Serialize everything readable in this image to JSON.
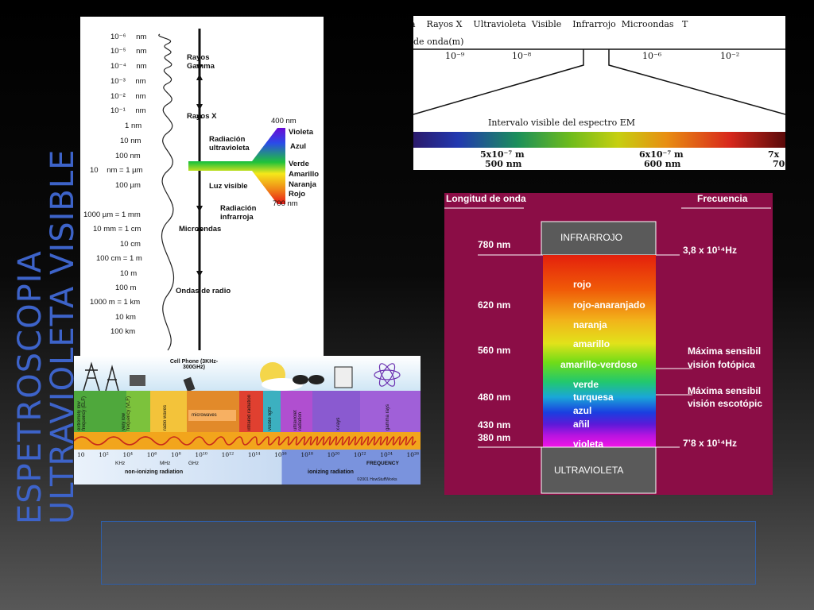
{
  "slide": {
    "title": "ESPETROSCOPIA ULTRAVIOLETA VISIBLE"
  },
  "em_spectrum": {
    "scale_ticks": [
      "10⁻⁶",
      "10⁻⁵",
      "10⁻⁴",
      "10⁻³",
      "10⁻²",
      "10⁻¹",
      "1",
      "10",
      "100",
      "10",
      "100",
      "1000 µm = 1",
      "10 mm = 1",
      "10",
      "100 cm = 1",
      "10",
      "100",
      "1000 m = 1",
      "10",
      "100"
    ],
    "scale_units": [
      "nm",
      "nm",
      "nm",
      "nm",
      "nm",
      "nm",
      "nm",
      "nm",
      "nm",
      "nm = 1 µm",
      "µm",
      "mm",
      "cm",
      "cm",
      "m",
      "m",
      "m",
      "km",
      "km",
      "km"
    ],
    "regions": [
      "Rayos Gamma",
      "Rayos X",
      "Radiación ultravioleta",
      "Luz visible",
      "Radiación infrarroja",
      "Microondas",
      "Ondas de radio"
    ],
    "visible_labels": [
      "400 nm",
      "Violeta",
      "Azul",
      "Verde",
      "Amarillo",
      "Naranja",
      "Rojo",
      "700 nm"
    ]
  },
  "em_range": {
    "header": "a    Rayos X    Ultravioleta  Visible    Infrarrojo  Microondas   T",
    "wavelength_label": "de onda(m)",
    "ticks": [
      "10⁻⁹",
      "10⁻⁸",
      "10⁻⁶",
      "10⁻²"
    ],
    "interval_label": "Intervalo visible del espectro EM",
    "bottom_labels": [
      {
        "sci": "5x10⁻⁷ m",
        "nm": "500 nm"
      },
      {
        "sci": "6x10⁻⁷ m",
        "nm": "600 nm"
      },
      {
        "sci": "7x",
        "nm": "70"
      }
    ]
  },
  "bands": {
    "top_label": "Cell Phone (3KHz-300GHz)",
    "band_names": [
      "extremely low frequency (ELF)",
      "very low frequency (VLF)",
      "radio waves",
      "microwaves",
      "infrared radiation",
      "visible light",
      "ultraviolet radiation",
      "x-rays",
      "gamma rays"
    ],
    "freq_ticks": [
      "10",
      "10²",
      "10⁴",
      "10⁶",
      "10⁸",
      "10¹⁰",
      "10¹²",
      "10¹⁴",
      "10¹⁶",
      "10¹⁸",
      "10²⁰",
      "10²²",
      "10²⁴",
      "10²⁶"
    ],
    "unit_ticks": [
      "KHz",
      "MHz",
      "GHz"
    ],
    "frequency_label": "FREQUENCY",
    "non_ionizing": "non-ionizing radiation",
    "ionizing": "ionizing radiation",
    "copyright": "©2001 HowStuffWorks"
  },
  "visible_chart": {
    "col_wavelength": "Longitud de onda",
    "col_frequency": "Frecuencia",
    "infrared_box": "INFRARROJO",
    "ultraviolet_box": "ULTRAVIOLETA",
    "wavelengths": [
      "780 nm",
      "620 nm",
      "560 nm",
      "480 nm",
      "430 nm",
      "380 nm"
    ],
    "colors": [
      "rojo",
      "rojo-anaranjado",
      "naranja",
      "amarillo",
      "amarillo-verdoso",
      "verde",
      "turquesa",
      "azul",
      "añil",
      "violeta"
    ],
    "freq_top": "3,8 x 10¹⁴Hz",
    "freq_bottom": "7’8 x 10¹⁴Hz",
    "note_photopic": [
      "Máxima sensibil",
      "visión fotópica"
    ],
    "note_scotopic": [
      "Máxima sensibil",
      "visión escotópic"
    ]
  },
  "caption": {
    "text": ""
  }
}
